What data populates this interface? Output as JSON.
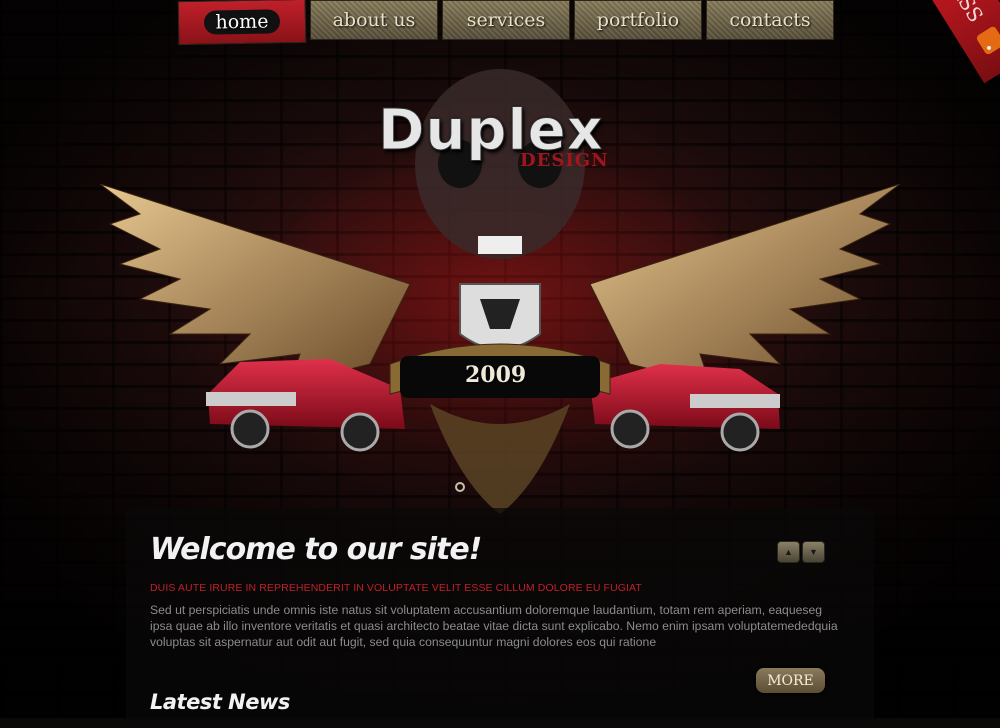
{
  "nav": {
    "items": [
      {
        "label": "home",
        "active": true
      },
      {
        "label": "about us",
        "active": false
      },
      {
        "label": "services",
        "active": false
      },
      {
        "label": "portfolio",
        "active": false
      },
      {
        "label": "contacts",
        "active": false
      }
    ]
  },
  "rss": {
    "label": "RSS",
    "icon": "rss-feed-icon"
  },
  "logo": {
    "main": "Duplex",
    "sub": "DESIGN"
  },
  "banner": {
    "year": "2009"
  },
  "welcome": {
    "title": "Welcome to our site!",
    "lead": "DUIS AUTE IRURE IN REPREHENDERIT IN VOLUPTATE VELIT ESSE CILLUM DOLORE EU FUGIAT",
    "body": "Sed ut perspiciatis unde omnis iste natus sit voluptatem accusantium doloremque laudantium, totam rem aperiam, eaqueseg ipsa quae ab illo inventore veritatis et quasi architecto beatae vitae dicta sunt explicabo. Nemo enim ipsam voluptatemededquia voluptas sit aspernatur aut odit aut fugit, sed quia consequuntur magni dolores eos qui ratione",
    "more": "MORE"
  },
  "news": {
    "title": "Latest News"
  },
  "colors": {
    "accent": "#c0202a",
    "nav": "#7a6f52",
    "text": "#8c8c8c"
  }
}
